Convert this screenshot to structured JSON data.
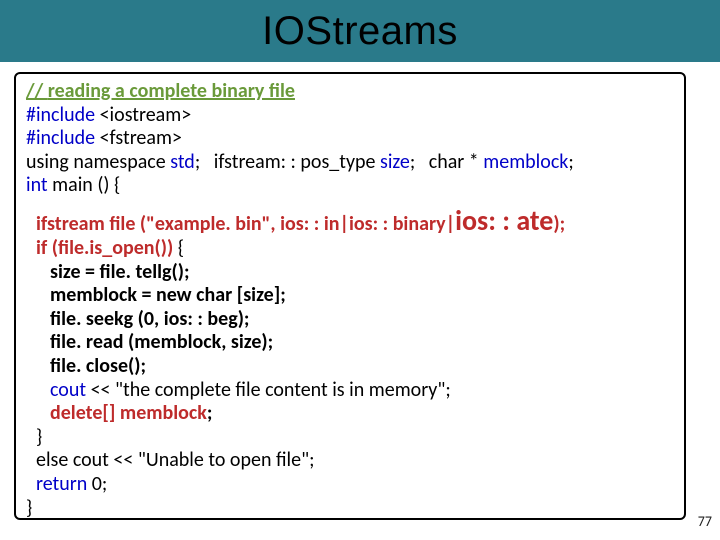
{
  "title": "IOStreams",
  "code": {
    "comment_prefix": "// ",
    "comment_text": "reading a complete binary file",
    "include1_kw": "#include",
    "include1_rest": " <iostream>",
    "include2_kw": "#include",
    "include2_rest": " <fstream>",
    "line3_a": "using namespace ",
    "line3_b": "std",
    "line3_c": ";   ifstream: : pos_type ",
    "line3_d": "size",
    "line3_e": ";   char * ",
    "line3_f": "memblock",
    "line3_g": ";",
    "main_a": "int",
    "main_b": " main () {",
    "fstream_a": "ifstream file (\"example. bin\", ios: : in|ios: : binary|",
    "fstream_b": "ios: : ate",
    "fstream_c": ");",
    "if_a": "if (file.is_open())",
    "if_b": " {",
    "s1": "size = file. tellg();",
    "s2": "memblock = new char [size];",
    "s3": "file. seekg (0, ios: : beg);",
    "s4": "file. read (memblock, size);",
    "s5": "file. close();",
    "cout_a": "cout",
    "cout_b": " << \"the complete file content is in memory\";",
    "del_a": "delete[] ",
    "del_b": "memblock",
    "del_c": ";",
    "brace_close1": "}",
    "else_a": "else cout",
    "else_b": " << \"Unable to open file\";",
    "ret_a": "return",
    "ret_b": " 0;",
    "brace_close2": "}"
  },
  "page_number": "77"
}
